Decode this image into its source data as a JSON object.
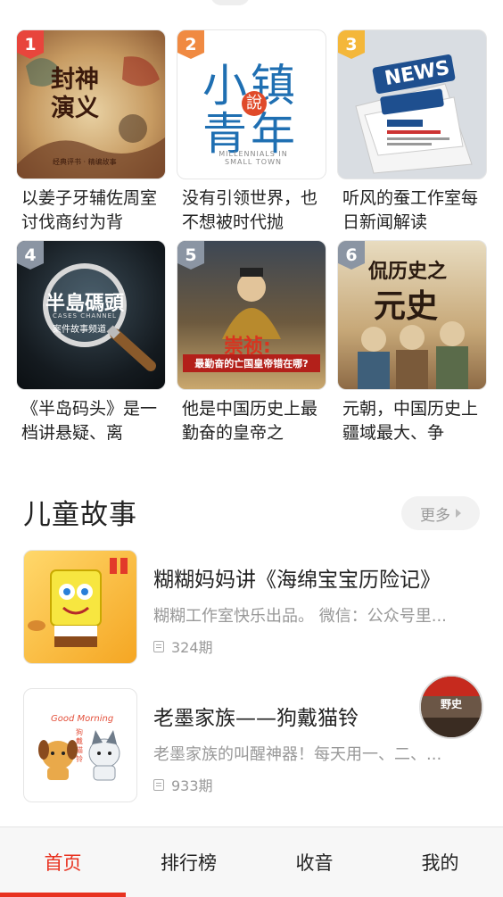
{
  "top_peek": {
    "label": ""
  },
  "rank_colors": [
    "#e8453c",
    "#f08a42",
    "#f4b73a",
    "#8b95a3",
    "#8b95a3",
    "#8b95a3"
  ],
  "grid": [
    {
      "rank": "1",
      "title": "以姜子牙辅佐周室讨伐商纣为背",
      "cover_text": "封神演义",
      "cover_sub": "经典评书 · 精编故事"
    },
    {
      "rank": "2",
      "title": "没有引领世界，也不想被时代抛",
      "cover_text_top": "小镇",
      "cover_text_bottom": "青年",
      "cover_seal": "說",
      "cover_sub": "MILLENNIALS IN SMALL TOWN"
    },
    {
      "rank": "3",
      "title": "听风的蚕工作室每日新闻解读",
      "cover_text": "NEWS"
    },
    {
      "rank": "4",
      "title": "《半岛码头》是一档讲悬疑、离",
      "cover_text": "半島碼頭",
      "cover_sub_en": "CASES CHANNEL",
      "cover_sub": "案件故事频道"
    },
    {
      "rank": "5",
      "title": "他是中国历史上最勤奋的皇帝之",
      "cover_text": "崇祯:",
      "cover_sub": "最勤奋的亡国皇帝错在哪?"
    },
    {
      "rank": "6",
      "title": "元朝，中国历史上疆域最大、争",
      "cover_text_top": "侃历史之",
      "cover_text_bottom": "元史"
    }
  ],
  "section": {
    "title": "儿童故事",
    "more_label": "更多"
  },
  "list": [
    {
      "title": "糊糊妈妈讲《海绵宝宝历险记》",
      "desc": "糊糊工作室快乐出品。 微信：公众号里...",
      "episodes": "324期"
    },
    {
      "title": "老墨家族——狗戴猫铃",
      "desc": "老墨家族的叫醒神器！每天用一、二、...",
      "episodes": "933期",
      "thumb_text_top": "Good Morning",
      "thumb_text_side": "狗戴猫铃"
    }
  ],
  "float_avatar": {
    "label": "野史"
  },
  "tabbar": {
    "tabs": [
      {
        "label": "首页",
        "active": true
      },
      {
        "label": "排行榜",
        "active": false
      },
      {
        "label": "收音",
        "active": false
      },
      {
        "label": "我的",
        "active": false
      }
    ]
  }
}
